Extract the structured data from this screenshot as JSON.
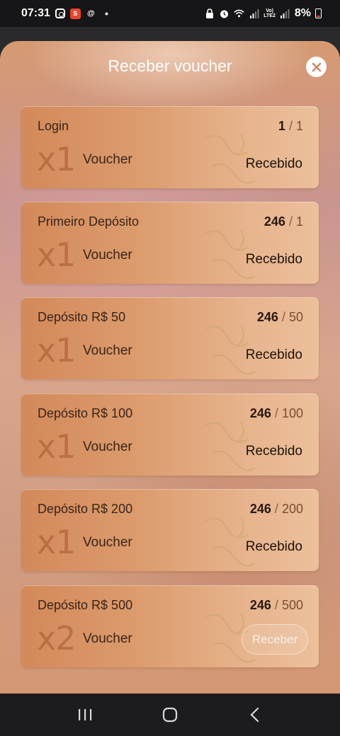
{
  "statusbar": {
    "time": "07:31",
    "battery": "8%",
    "network_top": "Vo)",
    "network_bottom": "LTE2",
    "app_badge": "S"
  },
  "modal": {
    "title": "Receber voucher",
    "close_icon": "close-icon"
  },
  "cards": [
    {
      "name": "Login",
      "current": "1",
      "target": "1",
      "multiplier": "x1",
      "voucher_label": "Voucher",
      "status": "Recebido"
    },
    {
      "name": "Primeiro Depósito",
      "current": "246",
      "target": "1",
      "multiplier": "x1",
      "voucher_label": "Voucher",
      "status": "Recebido"
    },
    {
      "name": "Depósito R$ 50",
      "current": "246",
      "target": "50",
      "multiplier": "x1",
      "voucher_label": "Voucher",
      "status": "Recebido"
    },
    {
      "name": "Depósito R$ 100",
      "current": "246",
      "target": "100",
      "multiplier": "x1",
      "voucher_label": "Voucher",
      "status": "Recebido"
    },
    {
      "name": "Depósito R$ 200",
      "current": "246",
      "target": "200",
      "multiplier": "x1",
      "voucher_label": "Voucher",
      "status": "Recebido"
    },
    {
      "name": "Depósito R$ 500",
      "current": "246",
      "target": "500",
      "multiplier": "x2",
      "voucher_label": "Voucher",
      "button": "Receber"
    }
  ],
  "progress_separator": "/",
  "navbar": {
    "recents_icon": "recents-icon",
    "home_icon": "home-icon",
    "back_icon": "back-icon"
  },
  "colors": {
    "card_gradient_start": "#d3895a",
    "card_gradient_end": "#ecc09c",
    "title_text": "#ffffff",
    "status_text": "#1e120a"
  }
}
